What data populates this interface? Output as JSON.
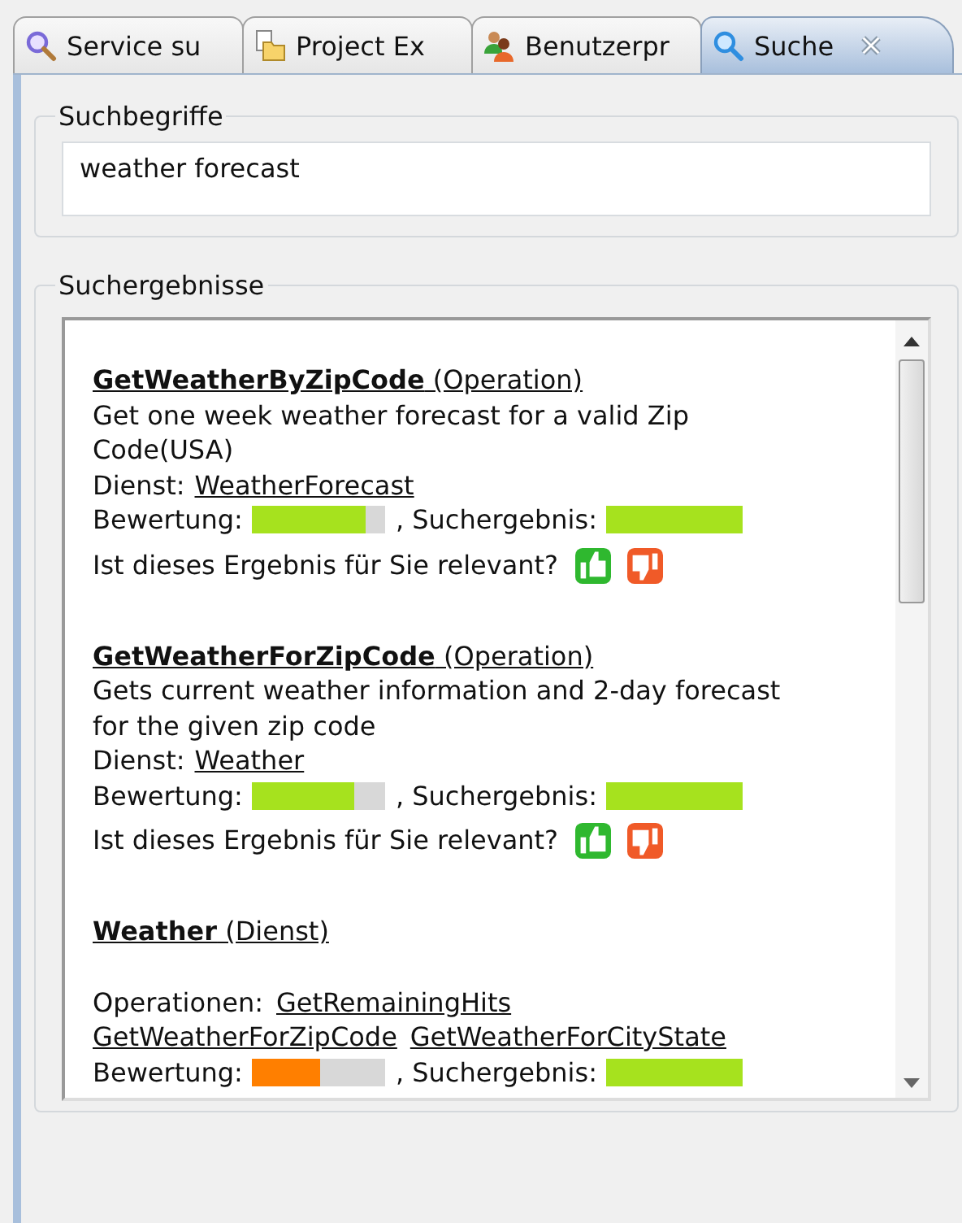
{
  "tabs": [
    {
      "label": "Service su",
      "kind": "search",
      "selected": false
    },
    {
      "label": "Project Ex",
      "kind": "project",
      "selected": false
    },
    {
      "label": "Benutzerpr",
      "kind": "users",
      "selected": false
    },
    {
      "label": "Suche",
      "kind": "search",
      "selected": true,
      "closable": true
    }
  ],
  "search_terms": {
    "label": "Suchbegriffe",
    "value": "weather forecast"
  },
  "results": {
    "label": "Suchergebnisse",
    "items": [
      {
        "kind": "operation",
        "title": "GetWeatherByZipCode",
        "type_label": "(Operation)",
        "description": "Get one week weather forecast for a valid Zip Code(USA)",
        "service_label": "Dienst:",
        "service": "WeatherForecast",
        "rating_label": "Bewertung:",
        "rating": {
          "level": 0.85,
          "color": "#a6e21e"
        },
        "match_label": ", Suchergebnis:",
        "match": {
          "level": 1,
          "color": "#a6e21e"
        },
        "question": "Ist dieses Ergebnis für Sie relevant?"
      },
      {
        "kind": "operation",
        "title": "GetWeatherForZipCode",
        "type_label": "(Operation)",
        "description": "Gets current weather information and 2-day forecast for the given zip code",
        "service_label": "Dienst:",
        "service": "Weather",
        "rating_label": "Bewertung:",
        "rating": {
          "level": 0.76,
          "color": "#a6e21e"
        },
        "match_label": ", Suchergebnis:",
        "match": {
          "level": 1,
          "color": "#a6e21e"
        },
        "question": "Ist dieses Ergebnis für Sie relevant?"
      },
      {
        "kind": "service",
        "title": "Weather",
        "type_label": "(Dienst)",
        "operations_label": "Operationen:",
        "operations": [
          "GetRemainingHits",
          "GetWeatherForZipCode",
          "GetWeatherForCityState"
        ],
        "rating_label": "Bewertung:",
        "rating": {
          "level": 0.51,
          "color": "#ff7f00"
        },
        "match_label": ", Suchergebnis:",
        "match": {
          "level": 1,
          "color": "#a6e21e"
        }
      }
    ]
  }
}
